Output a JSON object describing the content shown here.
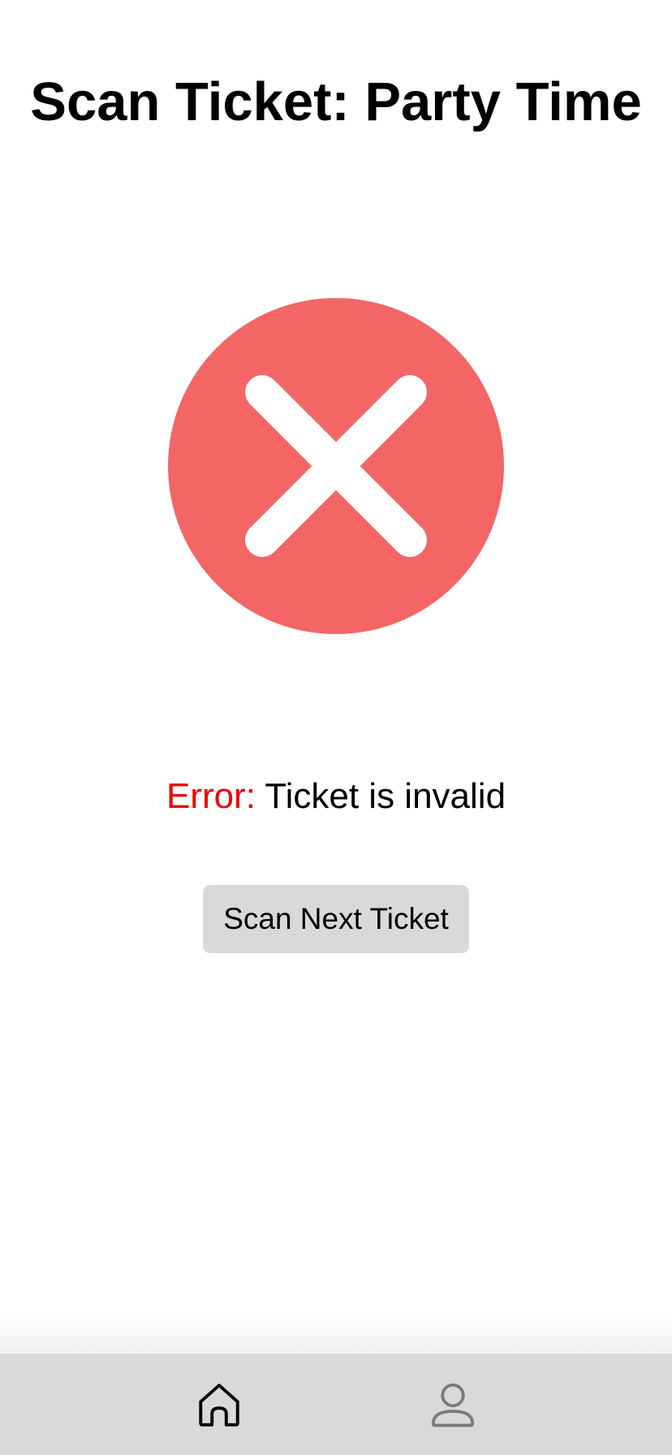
{
  "header": {
    "title": "Scan Ticket: Party Time"
  },
  "status": {
    "icon": "error-x-icon",
    "icon_color": "#f46566",
    "error_label": "Error:",
    "error_color": "#ee0000",
    "message": " Ticket is invalid"
  },
  "actions": {
    "scan_next_label": "Scan Next Ticket"
  },
  "bottom_nav": {
    "items": [
      {
        "icon": "home-icon",
        "active": true
      },
      {
        "icon": "profile-icon",
        "active": false
      }
    ]
  }
}
